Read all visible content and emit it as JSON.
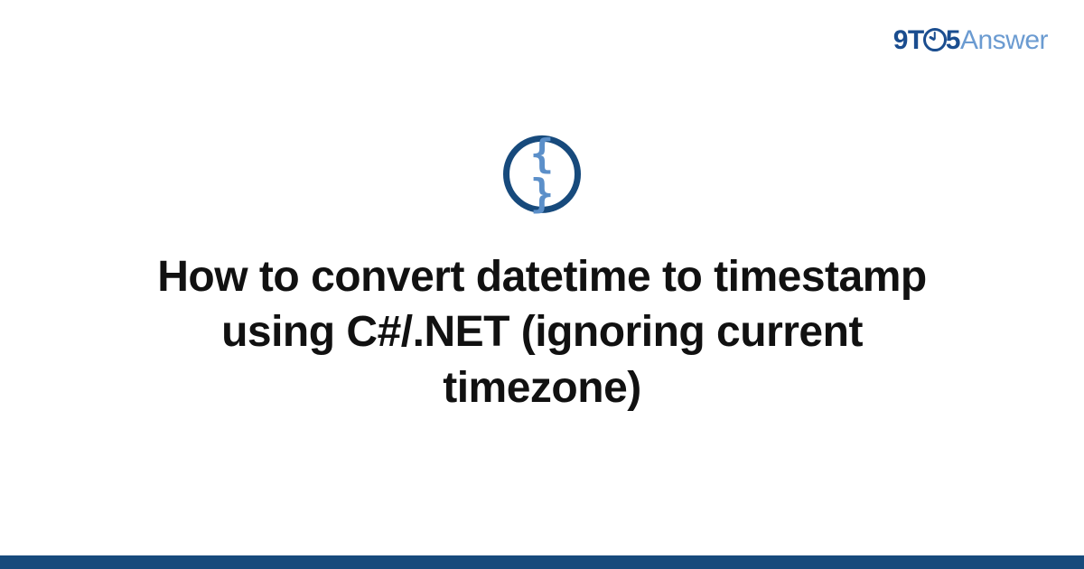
{
  "brand": {
    "part1": "9T",
    "part2": "5",
    "part3": "Answer"
  },
  "icon": {
    "glyph": "{ }"
  },
  "heading": "How to convert datetime to timestamp using C#/.NET (ignoring current timezone)"
}
